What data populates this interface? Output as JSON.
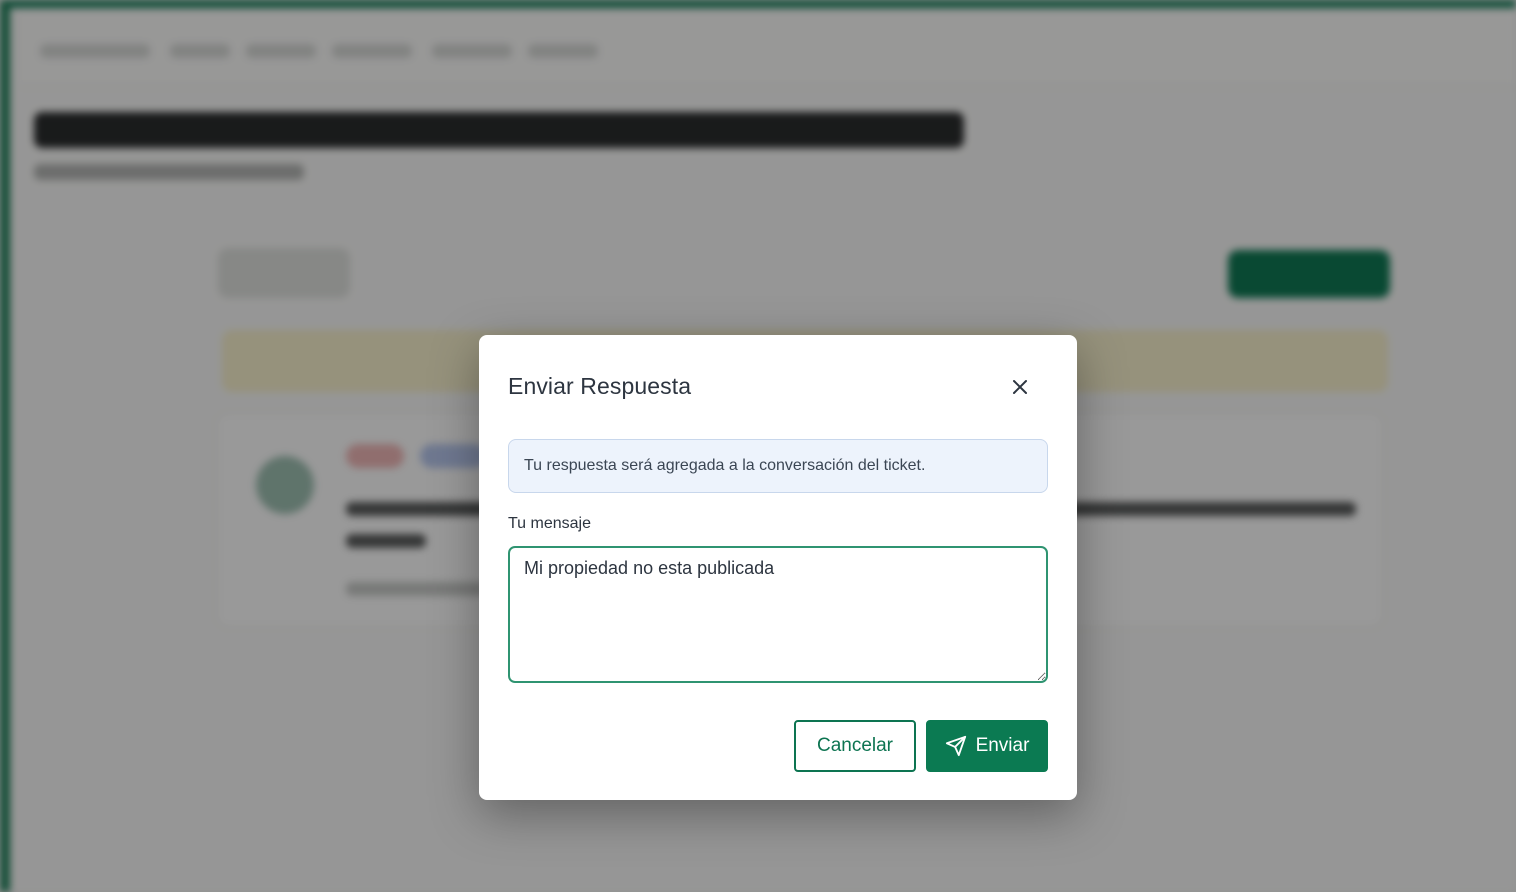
{
  "modal": {
    "title": "Enviar Respuesta",
    "info_text": "Tu respuesta será agregada a la conversación del ticket.",
    "message_label": "Tu mensaje",
    "message_value": "Mi propiedad no esta publicada",
    "cancel_label": "Cancelar",
    "send_label": "Enviar",
    "close_icon": "close-icon",
    "send_icon": "send-icon"
  },
  "colors": {
    "brand_green": "#0b7a52",
    "focus_border": "#2f9471",
    "info_background": "#edf3fc",
    "info_border": "#c8d7ec",
    "title_text": "#2d3540"
  }
}
